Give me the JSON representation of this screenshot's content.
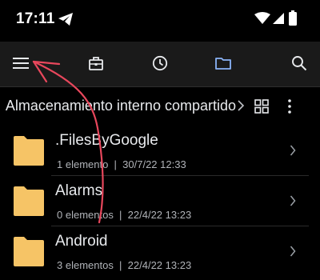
{
  "status_bar": {
    "time": "17:11",
    "telegram_icon": "telegram-icon",
    "wifi_icon": "wifi-icon",
    "signal_icon": "signal-icon",
    "battery_icon": "battery-icon"
  },
  "toolbar": {
    "menu_icon": "menu-icon",
    "tabs": [
      {
        "icon": "briefcase-icon"
      },
      {
        "icon": "clock-icon"
      },
      {
        "icon": "folder-icon",
        "active": true
      }
    ],
    "search_icon": "search-icon",
    "active_color": "#8ab4f8"
  },
  "breadcrumb": {
    "path": "Almacenamiento interno compartido",
    "view_toggle_icon": "grid-view-icon",
    "more_icon": "more-vert-icon"
  },
  "files": [
    {
      "name": ".FilesByGoogle",
      "items": "1 elemento",
      "date": "30/7/22 12:33"
    },
    {
      "name": "Alarms",
      "items": "0 elementos",
      "date": "22/4/22 13:23"
    },
    {
      "name": "Android",
      "items": "3 elementos",
      "date": "22/4/22 13:23"
    }
  ],
  "colors": {
    "background": "#000000",
    "toolbar": "#1a1a1a",
    "folder": "#f6c466",
    "annotation_arrow": "#e8475c"
  }
}
